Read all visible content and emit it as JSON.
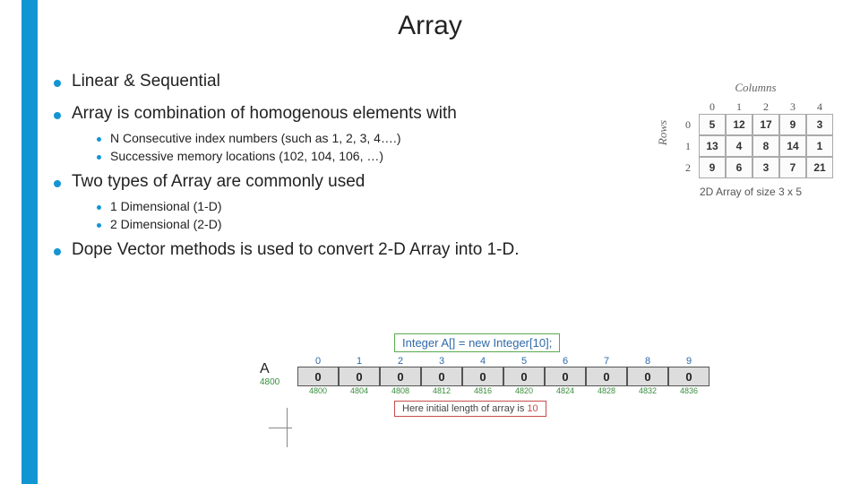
{
  "title": "Array",
  "bullets": {
    "b1": "Linear & Sequential",
    "b2": "Array is combination of homogenous  elements with",
    "b2subs": [
      "N Consecutive index numbers (such as 1, 2, 3, 4….)",
      "Successive memory locations (102, 104, 106, …)"
    ],
    "b3": "Two types of Array are commonly used",
    "b3subs": [
      "1 Dimensional (1-D)",
      "2 Dimensional (2-D)"
    ],
    "b4": "Dope Vector methods is used to convert 2-D Array into 1-D."
  },
  "fig2d": {
    "colsLabel": "Columns",
    "rowsLabel": "Rows",
    "colIdx": [
      "0",
      "1",
      "2",
      "3",
      "4"
    ],
    "rowIdx": [
      "0",
      "1",
      "2"
    ],
    "data": [
      [
        "5",
        "12",
        "17",
        "9",
        "3"
      ],
      [
        "13",
        "4",
        "8",
        "14",
        "1"
      ],
      [
        "9",
        "6",
        "3",
        "7",
        "21"
      ]
    ],
    "caption": "2D Array of size 3 x 5"
  },
  "fig1d": {
    "code": "Integer A[] = new Integer[10];",
    "varName": "A",
    "baseAddr": "4800",
    "indices": [
      "0",
      "1",
      "2",
      "3",
      "4",
      "5",
      "6",
      "7",
      "8",
      "9"
    ],
    "values": [
      "0",
      "0",
      "0",
      "0",
      "0",
      "0",
      "0",
      "0",
      "0",
      "0"
    ],
    "addrs": [
      "4800",
      "4804",
      "4808",
      "4812",
      "4816",
      "4820",
      "4824",
      "4828",
      "4832",
      "4836"
    ],
    "lenText": "Here initial length of array is ",
    "lenVal": "10"
  }
}
